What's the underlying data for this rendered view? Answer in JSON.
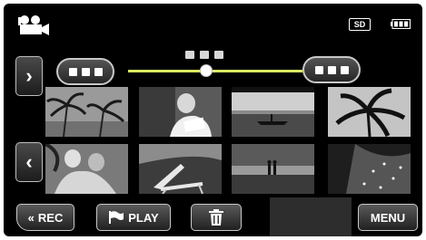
{
  "header": {
    "mode_icon": "video-camera-icon",
    "sd_badge": "SD",
    "battery_icon": "battery-icon"
  },
  "nav": {
    "next_glyph": "›",
    "prev_glyph": "‹"
  },
  "timeline": {
    "position": 0.45
  },
  "thumbnails": [
    {
      "scene": "palm-trees"
    },
    {
      "scene": "reading-woman"
    },
    {
      "scene": "boat-at-dusk"
    },
    {
      "scene": "palm-silhouette"
    },
    {
      "scene": "couple-embracing"
    },
    {
      "scene": "beach-chair"
    },
    {
      "scene": "couple-on-beach"
    },
    {
      "scene": "sparkling-water"
    }
  ],
  "bottom_bar": {
    "rec_label": "REC",
    "rec_glyph": "«",
    "play_label": "PLAY",
    "menu_label": "MENU"
  }
}
